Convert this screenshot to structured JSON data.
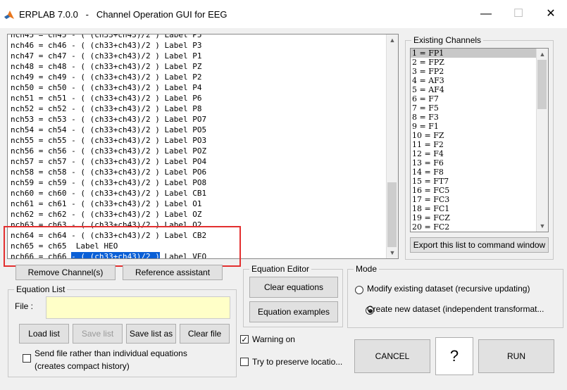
{
  "window": {
    "title": "ERPLAB 7.0.0   -   Channel Operation GUI for EEG",
    "minimize": "—",
    "maximize": "☐",
    "close": "✕"
  },
  "equations": [
    "nch45 = ch45 - ( (ch33+ch43)/2 ) Label P5",
    "nch46 = ch46 - ( (ch33+ch43)/2 ) Label P3",
    "nch47 = ch47 - ( (ch33+ch43)/2 ) Label P1",
    "nch48 = ch48 - ( (ch33+ch43)/2 ) Label PZ",
    "nch49 = ch49 - ( (ch33+ch43)/2 ) Label P2",
    "nch50 = ch50 - ( (ch33+ch43)/2 ) Label P4",
    "nch51 = ch51 - ( (ch33+ch43)/2 ) Label P6",
    "nch52 = ch52 - ( (ch33+ch43)/2 ) Label P8",
    "nch53 = ch53 - ( (ch33+ch43)/2 ) Label PO7",
    "nch54 = ch54 - ( (ch33+ch43)/2 ) Label PO5",
    "nch55 = ch55 - ( (ch33+ch43)/2 ) Label PO3",
    "nch56 = ch56 - ( (ch33+ch43)/2 ) Label POZ",
    "nch57 = ch57 - ( (ch33+ch43)/2 ) Label PO4",
    "nch58 = ch58 - ( (ch33+ch43)/2 ) Label PO6",
    "nch59 = ch59 - ( (ch33+ch43)/2 ) Label PO8",
    "nch60 = ch60 - ( (ch33+ch43)/2 ) Label CB1",
    "nch61 = ch61 - ( (ch33+ch43)/2 ) Label O1",
    "nch62 = ch62 - ( (ch33+ch43)/2 ) Label OZ",
    "nch63 = ch63 - ( (ch33+ch43)/2 ) Label O2",
    "nch64 = ch64 - ( (ch33+ch43)/2 ) Label CB2",
    "nch65 = ch65  Label HEO"
  ],
  "last_equation": {
    "prefix": "nch66 = ch66 ",
    "selected": "- ( (ch33+ch43)/2 )",
    "suffix": " Label VEO"
  },
  "buttons": {
    "remove_channels": "Remove Channel(s)",
    "reference_assistant": "Reference assistant",
    "clear_equations": "Clear equations",
    "equation_examples": "Equation examples",
    "load_list": "Load list",
    "save_list": "Save list",
    "save_list_as": "Save list as",
    "clear_file": "Clear file",
    "export_list": "Export this list to command window",
    "cancel": "CANCEL",
    "help": "?",
    "run": "RUN"
  },
  "existing_channels": {
    "title": "Existing Channels",
    "items": [
      "1 = FP1",
      "2 = FPZ",
      "3 = FP2",
      "4 = AF3",
      "5 = AF4",
      "6 = F7",
      "7 = F5",
      "8 = F3",
      "9 = F1",
      "10 = FZ",
      "11 = F2",
      "12 = F4",
      "13 = F6",
      "14 = F8",
      "15 = FT7",
      "16 = FC5",
      "17 = FC3",
      "18 = FC1",
      "19 = FCZ",
      "20 = FC2"
    ]
  },
  "equation_list": {
    "title": "Equation List",
    "file_label": "File :",
    "file_value": "",
    "send_file_label": "Send file rather than individual equations",
    "send_file_sub": "(creates compact history)"
  },
  "equation_editor": {
    "title": "Equation Editor"
  },
  "mode": {
    "title": "Mode",
    "option_modify": "Modify existing dataset (recursive updating)",
    "option_create": "Create new dataset (independent transformat..."
  },
  "options": {
    "warning_on": "Warning on",
    "preserve_location": "Try to preserve locatio..."
  },
  "colors": {
    "selection": "#0a5fd6",
    "highlight_frame": "#e32f2f",
    "file_field": "#ffffc8"
  }
}
